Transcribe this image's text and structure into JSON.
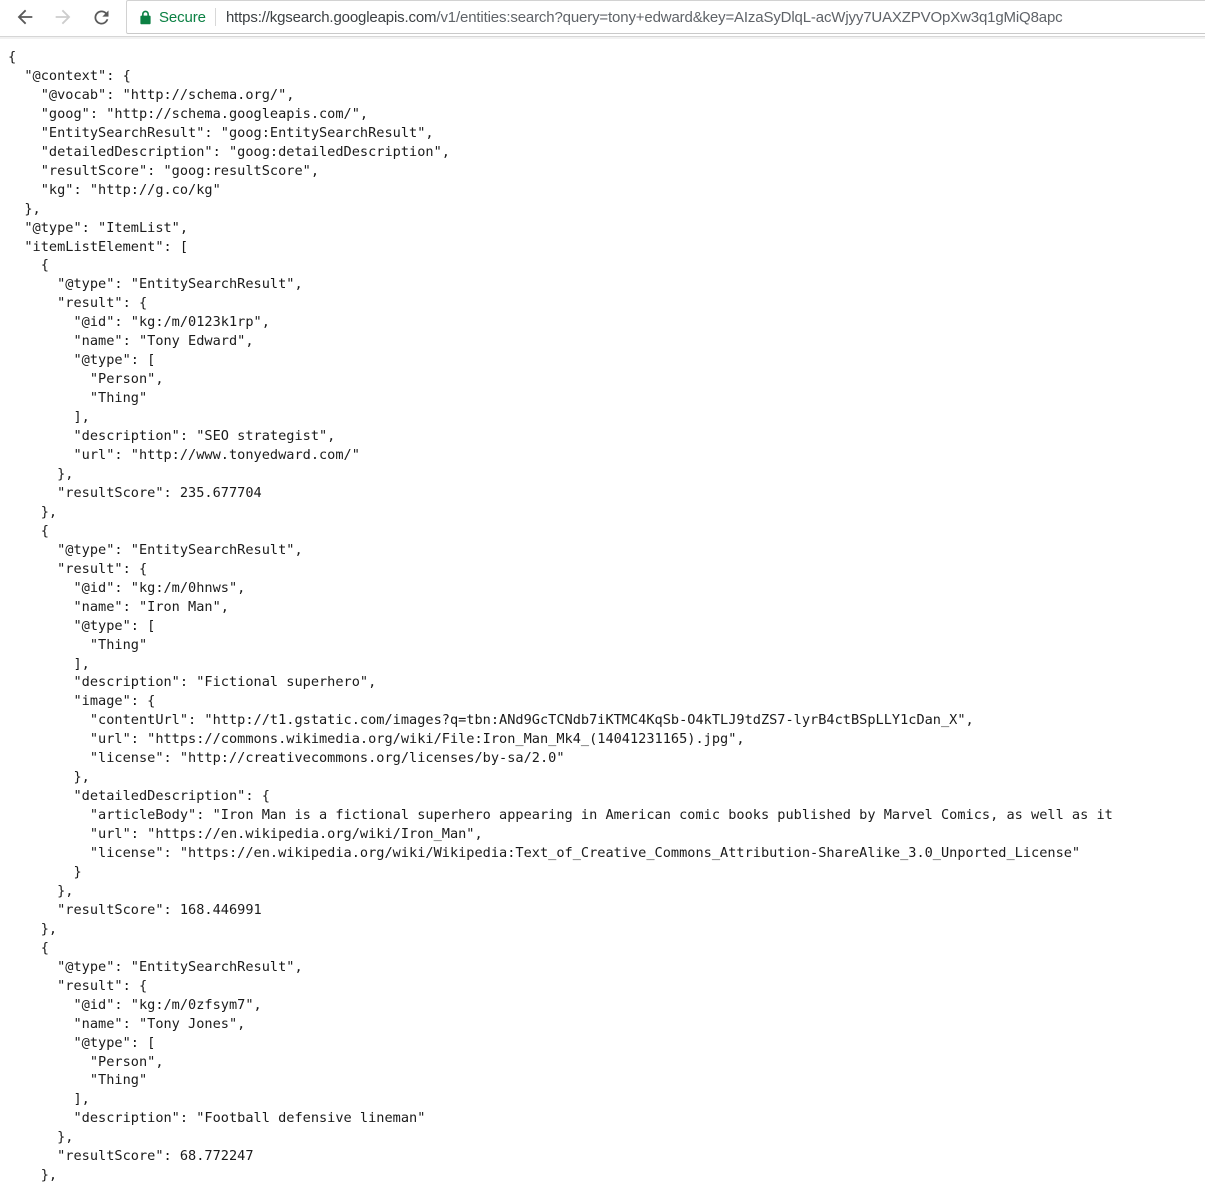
{
  "browser": {
    "back_icon": "arrow-left-icon",
    "forward_icon": "arrow-right-icon",
    "reload_icon": "reload-icon",
    "back_enabled": true,
    "forward_enabled": false,
    "security": {
      "lock_icon": "lock-icon",
      "label": "Secure",
      "color": "#0b8043"
    },
    "url": "https://kgsearch.googleapis.com/v1/entities:search?query=tony+edward&key=AIzaSyDlqL-acWjyy7UAXZPVOpXw3q1gMiQ8apc",
    "url_origin": "https://kgsearch.googleapis.com",
    "url_path": "/v1/entities:search?query=tony+edward&key=AIzaSyDlqL-acWjyy7UAXZPVOpXw3q1gMiQ8apc"
  },
  "response": {
    "content_type": "application/json",
    "raw_text": "{\n  \"@context\": {\n    \"@vocab\": \"http://schema.org/\",\n    \"goog\": \"http://schema.googleapis.com/\",\n    \"EntitySearchResult\": \"goog:EntitySearchResult\",\n    \"detailedDescription\": \"goog:detailedDescription\",\n    \"resultScore\": \"goog:resultScore\",\n    \"kg\": \"http://g.co/kg\"\n  },\n  \"@type\": \"ItemList\",\n  \"itemListElement\": [\n    {\n      \"@type\": \"EntitySearchResult\",\n      \"result\": {\n        \"@id\": \"kg:/m/0123k1rp\",\n        \"name\": \"Tony Edward\",\n        \"@type\": [\n          \"Person\",\n          \"Thing\"\n        ],\n        \"description\": \"SEO strategist\",\n        \"url\": \"http://www.tonyedward.com/\"\n      },\n      \"resultScore\": 235.677704\n    },\n    {\n      \"@type\": \"EntitySearchResult\",\n      \"result\": {\n        \"@id\": \"kg:/m/0hnws\",\n        \"name\": \"Iron Man\",\n        \"@type\": [\n          \"Thing\"\n        ],\n        \"description\": \"Fictional superhero\",\n        \"image\": {\n          \"contentUrl\": \"http://t1.gstatic.com/images?q=tbn:ANd9GcTCNdb7iKTMC4KqSb-O4kTLJ9tdZS7-lyrB4ctBSpLLY1cDan_X\",\n          \"url\": \"https://commons.wikimedia.org/wiki/File:Iron_Man_Mk4_(14041231165).jpg\",\n          \"license\": \"http://creativecommons.org/licenses/by-sa/2.0\"\n        },\n        \"detailedDescription\": {\n          \"articleBody\": \"Iron Man is a fictional superhero appearing in American comic books published by Marvel Comics, as well as it\n          \"url\": \"https://en.wikipedia.org/wiki/Iron_Man\",\n          \"license\": \"https://en.wikipedia.org/wiki/Wikipedia:Text_of_Creative_Commons_Attribution-ShareAlike_3.0_Unported_License\"\n        }\n      },\n      \"resultScore\": 168.446991\n    },\n    {\n      \"@type\": \"EntitySearchResult\",\n      \"result\": {\n        \"@id\": \"kg:/m/0zfsym7\",\n        \"name\": \"Tony Jones\",\n        \"@type\": [\n          \"Person\",\n          \"Thing\"\n        ],\n        \"description\": \"Football defensive lineman\"\n      },\n      \"resultScore\": 68.772247\n    },"
  },
  "json_payload": {
    "@context": {
      "@vocab": "http://schema.org/",
      "goog": "http://schema.googleapis.com/",
      "EntitySearchResult": "goog:EntitySearchResult",
      "detailedDescription": "goog:detailedDescription",
      "resultScore": "goog:resultScore",
      "kg": "http://g.co/kg"
    },
    "@type": "ItemList",
    "itemListElement": [
      {
        "@type": "EntitySearchResult",
        "result": {
          "@id": "kg:/m/0123k1rp",
          "name": "Tony Edward",
          "@type": [
            "Person",
            "Thing"
          ],
          "description": "SEO strategist",
          "url": "http://www.tonyedward.com/"
        },
        "resultScore": 235.677704
      },
      {
        "@type": "EntitySearchResult",
        "result": {
          "@id": "kg:/m/0hnws",
          "name": "Iron Man",
          "@type": [
            "Thing"
          ],
          "description": "Fictional superhero",
          "image": {
            "contentUrl": "http://t1.gstatic.com/images?q=tbn:ANd9GcTCNdb7iKTMC4KqSb-O4kTLJ9tdZS7-lyrB4ctBSpLLY1cDan_X",
            "url": "https://commons.wikimedia.org/wiki/File:Iron_Man_Mk4_(14041231165).jpg",
            "license": "http://creativecommons.org/licenses/by-sa/2.0"
          },
          "detailedDescription": {
            "articleBody": "Iron Man is a fictional superhero appearing in American comic books published by Marvel Comics, as well as it",
            "url": "https://en.wikipedia.org/wiki/Iron_Man",
            "license": "https://en.wikipedia.org/wiki/Wikipedia:Text_of_Creative_Commons_Attribution-ShareAlike_3.0_Unported_License"
          }
        },
        "resultScore": 168.446991
      },
      {
        "@type": "EntitySearchResult",
        "result": {
          "@id": "kg:/m/0zfsym7",
          "name": "Tony Jones",
          "@type": [
            "Person",
            "Thing"
          ],
          "description": "Football defensive lineman"
        },
        "resultScore": 68.772247
      }
    ]
  }
}
